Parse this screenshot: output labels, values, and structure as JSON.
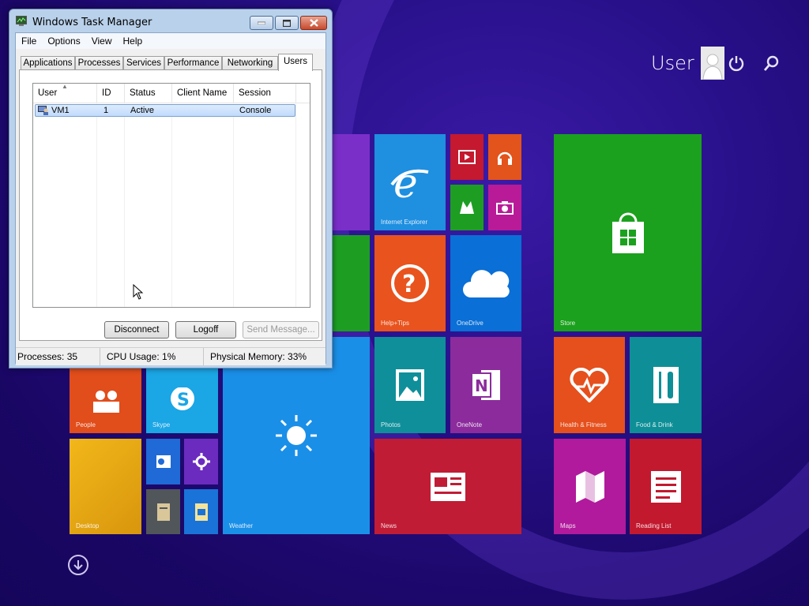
{
  "window": {
    "title": "Windows Task Manager"
  },
  "menu": [
    "File",
    "Options",
    "View",
    "Help"
  ],
  "tabs": [
    "Applications",
    "Processes",
    "Services",
    "Performance",
    "Networking",
    "Users"
  ],
  "active_tab": "Users",
  "users_list": {
    "columns": [
      "User",
      "ID",
      "Status",
      "Client Name",
      "Session"
    ],
    "sorted_by": "User",
    "rows": [
      {
        "user": "VM1",
        "id": "1",
        "status": "Active",
        "client_name": "",
        "session": "Console",
        "selected": true
      }
    ]
  },
  "buttons": {
    "disconnect": "Disconnect",
    "logoff": "Logoff",
    "send_message": "Send Message..."
  },
  "status": {
    "processes": "Processes: 35",
    "cpu": "CPU Usage: 1%",
    "memory": "Physical Memory: 33%"
  },
  "start_screen": {
    "user_name": "User",
    "header_icons": [
      "power-icon",
      "search-icon"
    ],
    "tiles": [
      {
        "name": "internet-explorer",
        "icon": "ie-icon",
        "label": "Internet Explorer",
        "color": "#1f8fe0"
      },
      {
        "name": "video",
        "icon": "video-icon",
        "label": "",
        "color": "#c4192f"
      },
      {
        "name": "music",
        "icon": "headphones-icon",
        "label": "",
        "color": "#e3531c"
      },
      {
        "name": "games",
        "icon": "gamepad-icon",
        "label": "",
        "color": "#1d9e22"
      },
      {
        "name": "camera",
        "icon": "camera-icon",
        "label": "",
        "color": "#b91b98"
      },
      {
        "name": "store",
        "icon": "store-icon",
        "label": "Store",
        "color": "#1ba11d"
      },
      {
        "name": "help-tips",
        "icon": "question-icon",
        "label": "Help+Tips",
        "color": "#e9531d"
      },
      {
        "name": "onedrive",
        "icon": "cloud-icon",
        "label": "OneDrive",
        "color": "#0a6fd6"
      },
      {
        "name": "photos",
        "icon": "photo-icon",
        "label": "Photos",
        "color": "#0f8f9a"
      },
      {
        "name": "onenote",
        "icon": "onenote-icon",
        "label": "OneNote",
        "color": "#8c2c9c"
      },
      {
        "name": "health-fitness",
        "icon": "heart-icon",
        "label": "Health & Fitness",
        "color": "#e5501d"
      },
      {
        "name": "food-drink",
        "icon": "food-icon",
        "label": "Food & Drink",
        "color": "#0e8f97"
      },
      {
        "name": "people",
        "icon": "people-icon",
        "label": "People",
        "color": "#e14d1b"
      },
      {
        "name": "skype",
        "icon": "skype-icon",
        "label": "Skype",
        "color": "#1ba6e6"
      },
      {
        "name": "weather",
        "icon": "sun-icon",
        "label": "Weather",
        "color": "#1a8fe8"
      },
      {
        "name": "desktop",
        "icon": "desktop-icon",
        "label": "Desktop",
        "color": "#e7ac12"
      },
      {
        "name": "outlook-small",
        "icon": "outlook-icon",
        "label": "",
        "color": "#1f6ad6"
      },
      {
        "name": "settings-small",
        "icon": "gear-icon",
        "label": "",
        "color": "#6b2bbf"
      },
      {
        "name": "files-small",
        "icon": "files-icon",
        "label": "",
        "color": "#51565a"
      },
      {
        "name": "calendar-small",
        "icon": "calendar-icon",
        "label": "",
        "color": "#1a73d8"
      },
      {
        "name": "news",
        "icon": "news-icon",
        "label": "News",
        "color": "#c11c35"
      },
      {
        "name": "maps",
        "icon": "maps-icon",
        "label": "Maps",
        "color": "#b11a9c"
      },
      {
        "name": "reading-list",
        "icon": "reading-icon",
        "label": "Reading List",
        "color": "#c2192f"
      },
      {
        "name": "purple-left",
        "icon": "",
        "label": "",
        "color": "#7b2fc9"
      },
      {
        "name": "green-left",
        "icon": "",
        "label": "",
        "color": "#1d9e22"
      },
      {
        "name": "blue-left",
        "icon": "",
        "label": "",
        "color": "#1a8fe8"
      }
    ]
  }
}
